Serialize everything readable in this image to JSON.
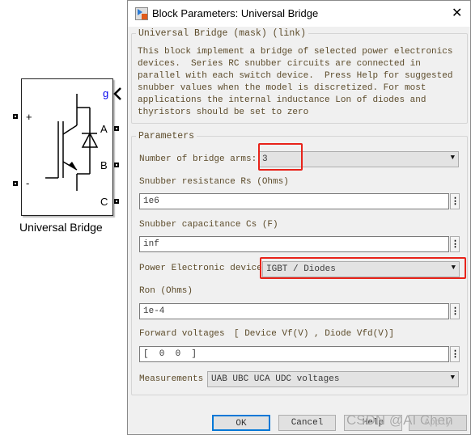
{
  "block": {
    "name": "Universal Bridge",
    "ports": {
      "plus": "+",
      "minus": "-",
      "g": "g",
      "a": "A",
      "b": "B",
      "c": "C"
    }
  },
  "dialog": {
    "title": "Block Parameters: Universal Bridge",
    "mask_title": "Universal Bridge (mask) (link)",
    "description": [
      "This block implement a bridge of selected power electronics",
      "devices.  Series RC snubber circuits are connected in",
      "parallel with each switch device.  Press Help for suggested",
      "snubber values when the model is discretized. For most",
      "applications the internal inductance Lon of diodes and",
      "thyristors should be set to zero"
    ],
    "parameters_title": "Parameters",
    "bridge_arms": {
      "label": "Number of bridge arms:",
      "value": "3"
    },
    "rs": {
      "label": "Snubber resistance Rs (Ohms)",
      "value": "1e6"
    },
    "cs": {
      "label": "Snubber capacitance Cs (F)",
      "value": "inf"
    },
    "device": {
      "label": "Power Electronic device",
      "value": "IGBT / Diodes"
    },
    "ron": {
      "label": "Ron (Ohms)",
      "value": "1e-4"
    },
    "vf": {
      "label": "Forward voltages",
      "label_hint": "[ Device Vf(V) , Diode Vfd(V)]",
      "value": "[  0  0  ]"
    },
    "measurements": {
      "label": "Measurements",
      "value": "UAB UBC UCA UDC voltages"
    },
    "buttons": {
      "ok": "OK",
      "cancel": "Cancel",
      "help": "Help",
      "apply": "Apply"
    },
    "more_icon": "⋮",
    "close_icon": "✕"
  },
  "watermark": "CSDN @AI Chen",
  "highlight_color": "#e8231a"
}
